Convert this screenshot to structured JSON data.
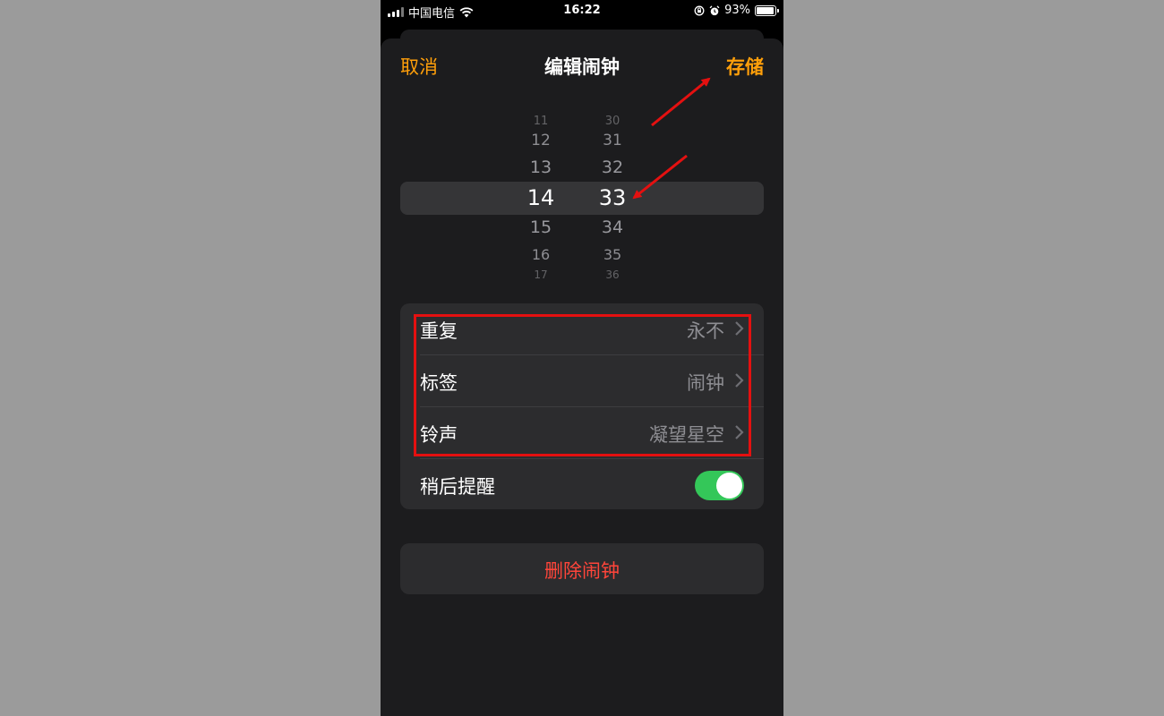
{
  "status_bar": {
    "carrier": "中国电信",
    "time": "16:22",
    "battery": "93%",
    "battery_level": 0.93
  },
  "nav": {
    "cancel": "取消",
    "title": "编辑闹钟",
    "save": "存储"
  },
  "picker": {
    "hours": [
      "11",
      "12",
      "13",
      "14",
      "15",
      "16",
      "17"
    ],
    "minutes": [
      "30",
      "31",
      "32",
      "33",
      "34",
      "35",
      "36"
    ],
    "selected_hour": "14",
    "selected_minute": "33"
  },
  "settings": {
    "repeat": {
      "label": "重复",
      "value": "永不"
    },
    "label": {
      "label": "标签",
      "value": "闹钟"
    },
    "sound": {
      "label": "铃声",
      "value": "凝望星空"
    },
    "snooze": {
      "label": "稍后提醒",
      "enabled": true
    }
  },
  "delete": "删除闹钟",
  "colors": {
    "accent": "#ff9f0a",
    "destructive": "#ff453a",
    "toggle_on": "#34c759",
    "annotation": "#e41010"
  }
}
